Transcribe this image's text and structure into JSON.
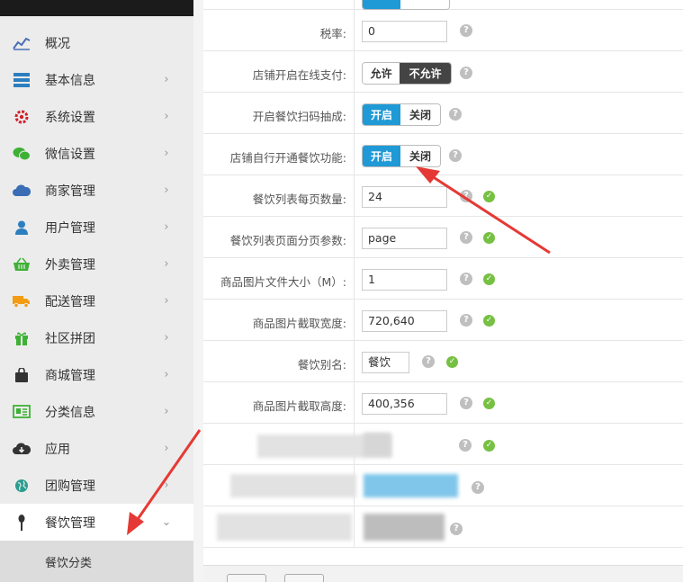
{
  "sidebar": {
    "items": [
      {
        "label": "概况",
        "icon": "chart-line-icon",
        "arrow": ""
      },
      {
        "label": "基本信息",
        "icon": "server-icon",
        "arrow": "›"
      },
      {
        "label": "系统设置",
        "icon": "gear-icon",
        "arrow": "›"
      },
      {
        "label": "微信设置",
        "icon": "wechat-icon",
        "arrow": "›"
      },
      {
        "label": "商家管理",
        "icon": "cloud-icon",
        "arrow": "›"
      },
      {
        "label": "用户管理",
        "icon": "user-icon",
        "arrow": "›"
      },
      {
        "label": "外卖管理",
        "icon": "basket-icon",
        "arrow": "›"
      },
      {
        "label": "配送管理",
        "icon": "truck-icon",
        "arrow": "›"
      },
      {
        "label": "社区拼团",
        "icon": "gift-icon",
        "arrow": "›"
      },
      {
        "label": "商城管理",
        "icon": "shopping-bag-icon",
        "arrow": "›"
      },
      {
        "label": "分类信息",
        "icon": "id-card-icon",
        "arrow": "›"
      },
      {
        "label": "应用",
        "icon": "cloud-download-icon",
        "arrow": "›"
      },
      {
        "label": "团购管理",
        "icon": "globe-icon",
        "arrow": "›"
      },
      {
        "label": "餐饮管理",
        "icon": "spoon-icon",
        "arrow": "⌄"
      }
    ],
    "submenu_label": "餐饮分类"
  },
  "form": {
    "tax_label": "税率:",
    "tax_value": "0",
    "online_pay_label": "店铺开启在线支付:",
    "online_pay_allow": "允许",
    "online_pay_deny": "不允许",
    "scan_label": "开启餐饮扫码抽成:",
    "scan_on": "开启",
    "scan_off": "关闭",
    "self_open_label": "店铺自行开通餐饮功能:",
    "self_open_on": "开启",
    "self_open_off": "关闭",
    "page_size_label": "餐饮列表每页数量:",
    "page_size_value": "24",
    "page_param_label": "餐饮列表页面分页参数:",
    "page_param_value": "page",
    "img_size_label": "商品图片文件大小（M）:",
    "img_size_value": "1",
    "img_width_label": "商品图片截取宽度:",
    "img_width_value": "720,640",
    "alias_label": "餐饮别名:",
    "alias_value": "餐饮",
    "img_height_label": "商品图片截取高度:",
    "img_height_value": "400,356",
    "help_glyph": "?",
    "ok_glyph": "✓"
  },
  "colors": {
    "accent_blue": "#1f9ad6",
    "dark_toggle": "#444444",
    "annotation_red": "#e53935",
    "success_green": "#76c043"
  }
}
